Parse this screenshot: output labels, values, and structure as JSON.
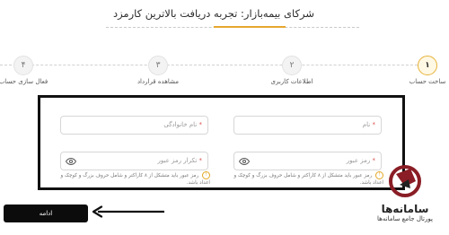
{
  "page": {
    "title": "شرکای بیمه‌بازار: تجربه دریافت بالاترین کارمزد"
  },
  "stepper": {
    "steps": [
      {
        "number": "۱",
        "label": "ساخت حساب",
        "active": true
      },
      {
        "number": "۲",
        "label": "اطلاعات کاربری",
        "active": false
      },
      {
        "number": "۳",
        "label": "مشاهده قرارداد",
        "active": false
      },
      {
        "number": "۴",
        "label": "فعال سازی حساب",
        "active": false
      }
    ]
  },
  "form": {
    "first_name_placeholder": "نام",
    "last_name_placeholder": "نام خانوادگی",
    "password_placeholder": "رمز عبور",
    "confirm_password_placeholder": "تکرار رمز عبور",
    "required_mark": "*",
    "password_hint": "رمز عبور باید متشکل از ۸ کاراکتر و شامل حروف بزرگ و کوچک و اعداد باشد.",
    "confirm_hint": "رمز عبور باید متشکل از ۸ کاراکتر و شامل حروف بزرگ و کوچک و اعداد باشد.",
    "hint_icon": "!"
  },
  "actions": {
    "submit_label": "ادامه"
  },
  "brand": {
    "name": "سامانه‌ها",
    "tagline": "پورتال جامع سامانه‌ها"
  },
  "colors": {
    "accent": "#e7a72e",
    "button": "#0c0c0c",
    "frame": "#111111"
  }
}
